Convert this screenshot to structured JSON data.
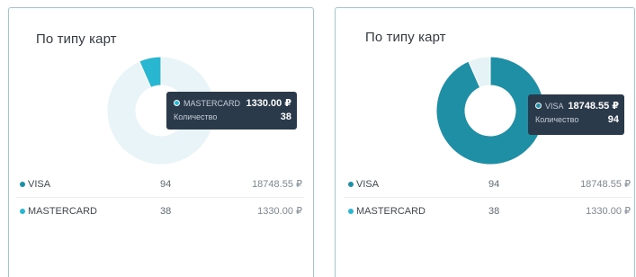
{
  "colors": {
    "visa_dark": "#1f8fa6",
    "visa_light": "#e8f4f7",
    "mastercard": "#29b6d1",
    "mastercard_light": "#e6f3f6",
    "tooltip_bg": "#2b3a4a"
  },
  "cards": [
    {
      "title": "По типу карт",
      "highlight": "MASTERCARD",
      "tooltip": {
        "series": "MASTERCARD",
        "amount": "1330.00 ₽",
        "count_label": "Количество",
        "count": "38"
      },
      "rows": [
        {
          "name": "VISA",
          "count": "94",
          "sum": "18748.55 ₽"
        },
        {
          "name": "MASTERCARD",
          "count": "38",
          "sum": "1330.00 ₽"
        }
      ]
    },
    {
      "title": "По типу карт",
      "highlight": "VISA",
      "tooltip": {
        "series": "VISA",
        "amount": "18748.55 ₽",
        "count_label": "Количество",
        "count": "94"
      },
      "rows": [
        {
          "name": "VISA",
          "count": "94",
          "sum": "18748.55 ₽"
        },
        {
          "name": "MASTERCARD",
          "count": "38",
          "sum": "1330.00 ₽"
        }
      ]
    }
  ],
  "chart_data": [
    {
      "type": "pie",
      "title": "По типу карт",
      "categories": [
        "VISA",
        "MASTERCARD"
      ],
      "values": [
        94,
        38
      ],
      "amounts": [
        18748.55,
        1330.0
      ]
    },
    {
      "type": "pie",
      "title": "По типу карт",
      "categories": [
        "VISA",
        "MASTERCARD"
      ],
      "values": [
        94,
        38
      ],
      "amounts": [
        18748.55,
        1330.0
      ]
    }
  ]
}
